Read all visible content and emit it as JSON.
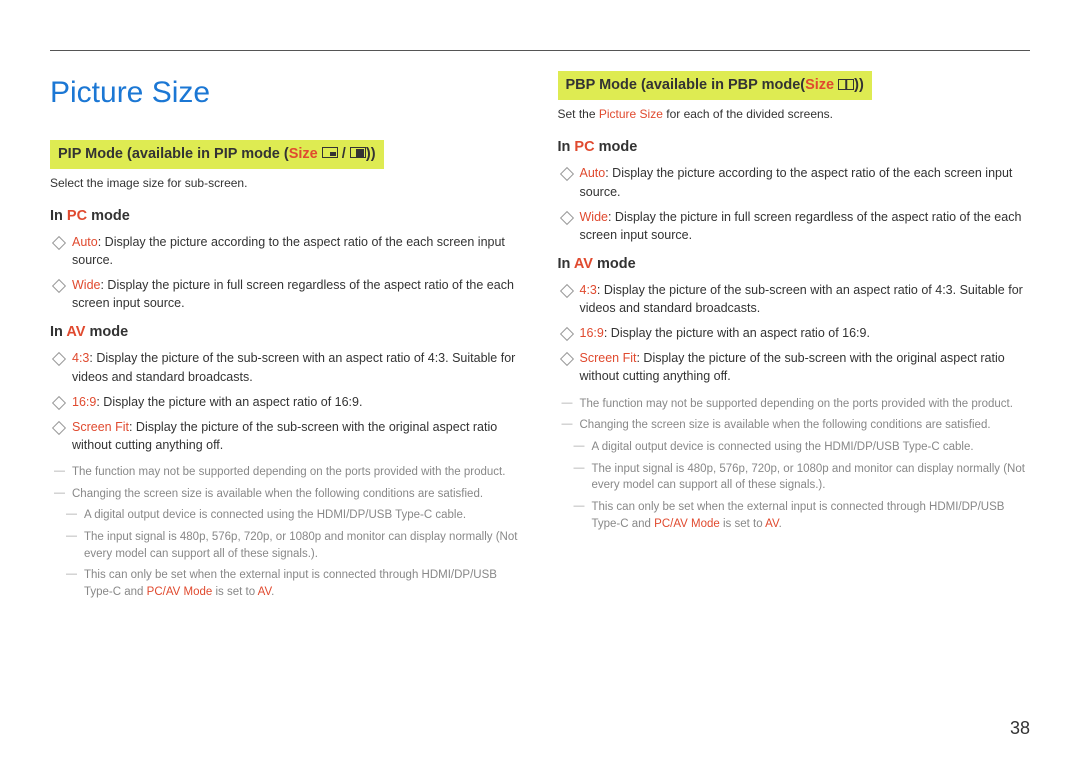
{
  "title": "Picture Size",
  "page_number": "38",
  "left": {
    "heading_pre": "PIP Mode (available in PIP mode (",
    "heading_hl": "Size",
    "heading_post": "))",
    "intro": "Select the image size for sub-screen.",
    "pc": {
      "label_pre": "In ",
      "label_hl": "PC",
      "label_post": " mode",
      "auto_k": "Auto",
      "auto_v": ": Display the picture according to the aspect ratio of the each screen input source.",
      "wide_k": "Wide",
      "wide_v": ": Display the picture in full screen regardless of the aspect ratio of the each screen input source."
    },
    "av": {
      "label_pre": "In ",
      "label_hl": "AV",
      "label_post": " mode",
      "r43_k": "4:3",
      "r43_v": ": Display the picture of the sub-screen with an aspect ratio of 4:3. Suitable for videos and standard broadcasts.",
      "r169_k": "16:9",
      "r169_v": ": Display the picture with an aspect ratio of 16:9.",
      "fit_k": "Screen Fit",
      "fit_v": ": Display the picture of the sub-screen with the original aspect ratio without cutting anything off."
    },
    "notes": {
      "n1": "The function may not be supported depending on the ports provided with the product.",
      "n2": "Changing the screen size is available when the following conditions are satisfied.",
      "n3": "A digital output device is connected using the HDMI/DP/USB Type-C cable.",
      "n4": "The input signal is 480p, 576p, 720p, or 1080p and monitor can display normally (Not every model can support all of these signals.).",
      "n5_pre": "This can only be set when the external input is connected through HDMI/DP/USB Type-C and ",
      "n5_hl1": "PC/AV Mode",
      "n5_mid": " is set to ",
      "n5_hl2": "AV",
      "n5_post": "."
    }
  },
  "right": {
    "heading_pre": "PBP Mode (available in PBP mode(",
    "heading_hl": "Size",
    "heading_post": "))",
    "intro_pre": "Set the ",
    "intro_hl": "Picture Size",
    "intro_post": " for each of the divided screens.",
    "pc": {
      "label_pre": "In ",
      "label_hl": "PC",
      "label_post": " mode",
      "auto_k": "Auto",
      "auto_v": ": Display the picture according to the aspect ratio of the each screen input source.",
      "wide_k": "Wide",
      "wide_v": ": Display the picture in full screen regardless of the aspect ratio of the each screen input source."
    },
    "av": {
      "label_pre": "In ",
      "label_hl": "AV",
      "label_post": " mode",
      "r43_k": "4:3",
      "r43_v": ": Display the picture of the sub-screen with an aspect ratio of 4:3. Suitable for videos and standard broadcasts.",
      "r169_k": "16:9",
      "r169_v": ": Display the picture with an aspect ratio of 16:9.",
      "fit_k": "Screen Fit",
      "fit_v": ": Display the picture of the sub-screen with the original aspect ratio without cutting anything off."
    },
    "notes": {
      "n1": "The function may not be supported depending on the ports provided with the product.",
      "n2": "Changing the screen size is available when the following conditions are satisfied.",
      "n3": "A digital output device is connected using the HDMI/DP/USB Type-C cable.",
      "n4": "The input signal is 480p, 576p, 720p, or 1080p and monitor can display normally (Not every model can support all of these signals.).",
      "n5_pre": "This can only be set when the external input is connected through HDMI/DP/USB Type-C and ",
      "n5_hl1": "PC/AV Mode",
      "n5_mid": " is set to ",
      "n5_hl2": "AV",
      "n5_post": "."
    }
  }
}
